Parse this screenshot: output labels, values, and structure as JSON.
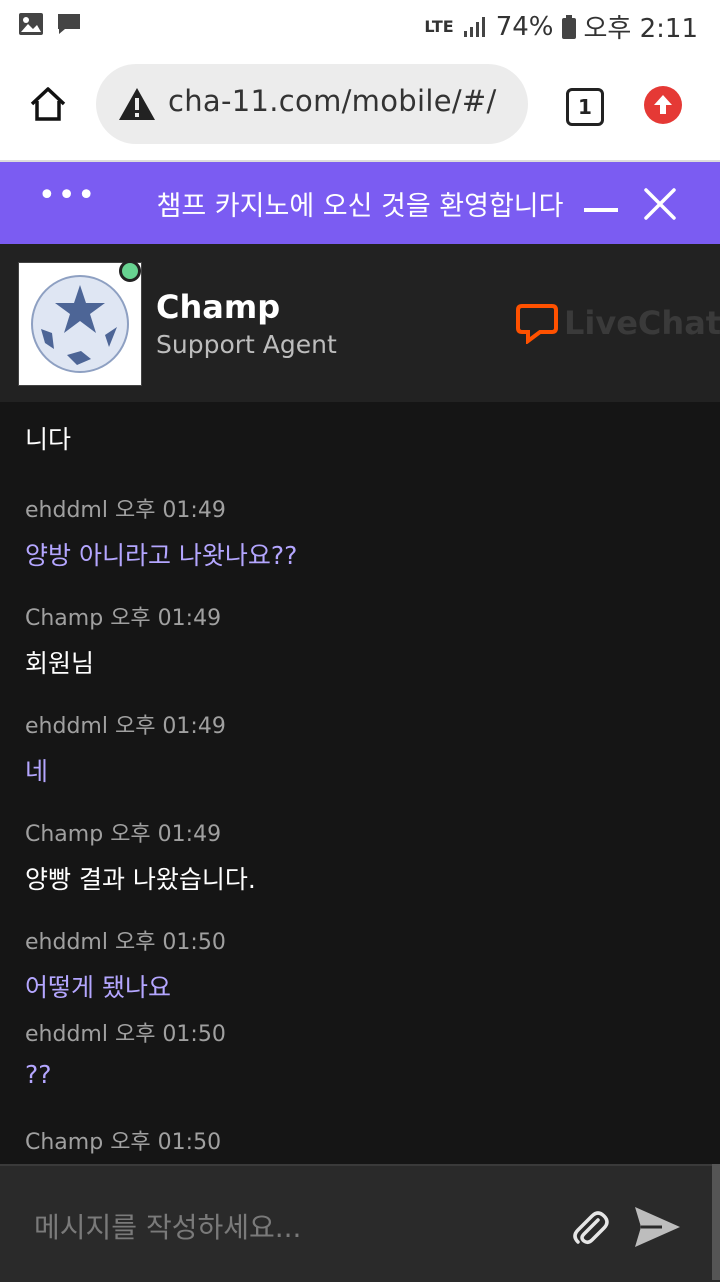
{
  "status": {
    "network": "LTE",
    "battery": "74%",
    "time": "오후 2:11"
  },
  "browser": {
    "url": "cha-11.com/mobile/#/",
    "tab_count": "1"
  },
  "chat": {
    "banner_title": "챔프 카지노에 오신 것을 환영합니다",
    "agent_name": "Champ",
    "agent_role": "Support Agent",
    "brand": "LiveChat",
    "truncated_message": "니다",
    "messages": [
      {
        "author": "ehddml",
        "time": "오후 01:49",
        "text": "양방 아니라고 나왓나요??"
      },
      {
        "author": "Champ",
        "time": "오후 01:49",
        "text": "회원님"
      },
      {
        "author": "ehddml",
        "time": "오후 01:49",
        "text": "네"
      },
      {
        "author": "Champ",
        "time": "오후 01:49",
        "text": "양빵 결과 나왔습니다."
      },
      {
        "author": "ehddml",
        "time": "오후 01:50",
        "text": "어떻게 됐나요"
      },
      {
        "author": "ehddml",
        "time": "오후 01:50",
        "text": "??"
      },
      {
        "author": "Champ",
        "time": "오후 01:50",
        "text": ""
      }
    ],
    "composer_placeholder": "메시지를 작성하세요..."
  },
  "colors": {
    "banner": "#7b5cf2",
    "user_text": "#b4a6ff",
    "online": "#68d391",
    "livechat_orange": "#ff5100"
  }
}
